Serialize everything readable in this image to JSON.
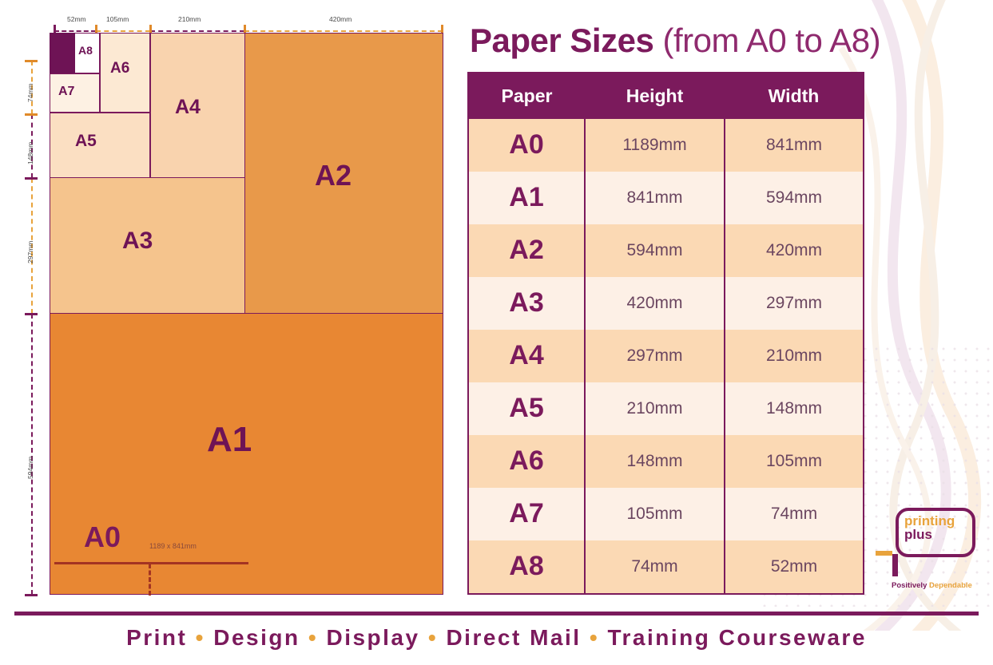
{
  "title": {
    "strong": "Paper Sizes",
    "light": "(from A0 to A8)"
  },
  "table": {
    "headers": [
      "Paper",
      "Height",
      "Width"
    ],
    "rows": [
      {
        "paper": "A0",
        "height": "1189mm",
        "width": "841mm"
      },
      {
        "paper": "A1",
        "height": "841mm",
        "width": "594mm"
      },
      {
        "paper": "A2",
        "height": "594mm",
        "width": "420mm"
      },
      {
        "paper": "A3",
        "height": "420mm",
        "width": "297mm"
      },
      {
        "paper": "A4",
        "height": "297mm",
        "width": "210mm"
      },
      {
        "paper": "A5",
        "height": "210mm",
        "width": "148mm"
      },
      {
        "paper": "A6",
        "height": "148mm",
        "width": "105mm"
      },
      {
        "paper": "A7",
        "height": "105mm",
        "width": "74mm"
      },
      {
        "paper": "A8",
        "height": "74mm",
        "width": "52mm"
      }
    ]
  },
  "diagram": {
    "sheets": [
      {
        "id": "A0",
        "label": "A0",
        "note": "1189 x 841mm"
      },
      {
        "id": "A1",
        "label": "A1"
      },
      {
        "id": "A2",
        "label": "A2"
      },
      {
        "id": "A3",
        "label": "A3"
      },
      {
        "id": "A4",
        "label": "A4"
      },
      {
        "id": "A5",
        "label": "A5"
      },
      {
        "id": "A6",
        "label": "A6"
      },
      {
        "id": "A7",
        "label": "A7"
      },
      {
        "id": "A8",
        "label": "A8"
      }
    ],
    "ruler_top": [
      "52mm",
      "105mm",
      "210mm",
      "420mm"
    ],
    "ruler_left": [
      "74mm",
      "148mm",
      "297mm",
      "594mm"
    ]
  },
  "logo": {
    "word1": "printing",
    "word2": "plus",
    "tagline_1": "Positively",
    "tagline_2": "Dependable"
  },
  "footer": {
    "items": [
      "Print",
      "Design",
      "Display",
      "Direct Mail",
      "Training Courseware"
    ],
    "separator": "•"
  },
  "colors": {
    "purple": "#7B1A5C",
    "orange": "#E8873A",
    "peach": "#FBD9B4",
    "cream": "#FDF0E6"
  }
}
